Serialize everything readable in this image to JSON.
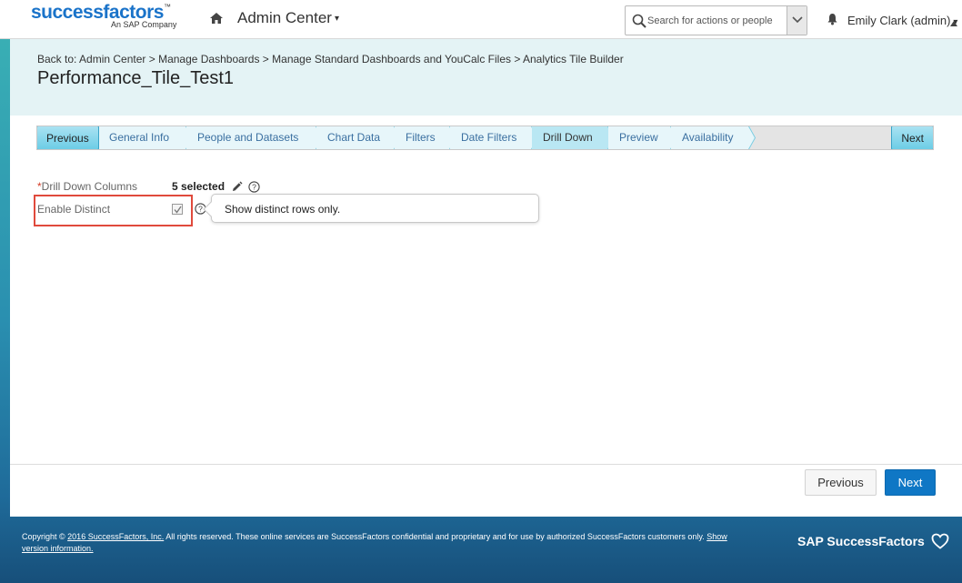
{
  "header": {
    "logo_text": "successfactors",
    "logo_tm": "™",
    "logo_sub": "An SAP Company",
    "nav_title": "Admin Center",
    "search_placeholder": "Search for actions or people",
    "user_name": "Emily Clark (admin)",
    "caret": "▾"
  },
  "title_area": {
    "breadcrumb": "Back to: Admin Center > Manage Dashboards > Manage Standard Dashboards and YouCalc Files > Analytics Tile Builder",
    "page_title": "Performance_Tile_Test1"
  },
  "wizard": {
    "previous_label": "Previous",
    "next_label": "Next",
    "steps": [
      {
        "label": "General Info",
        "active": false
      },
      {
        "label": "People and Datasets",
        "active": false
      },
      {
        "label": "Chart Data",
        "active": false
      },
      {
        "label": "Filters",
        "active": false
      },
      {
        "label": "Date Filters",
        "active": false
      },
      {
        "label": "Drill Down",
        "active": true
      },
      {
        "label": "Preview",
        "active": false
      },
      {
        "label": "Availability",
        "active": false
      }
    ]
  },
  "form": {
    "drill_down_required_mark": "*",
    "drill_down_label": "Drill Down Columns",
    "drill_down_value": "5 selected",
    "enable_distinct_label": "Enable Distinct",
    "enable_distinct_checked": true,
    "tooltip_text": "Show distinct rows only."
  },
  "actions": {
    "previous_label": "Previous",
    "next_label": "Next"
  },
  "footer": {
    "copyright_prefix": "Copyright ©",
    "copyright_link": "2016 SuccessFactors, Inc.",
    "copyright_body": "All rights reserved. These online services are SuccessFactors confidential and proprietary and for use by authorized SuccessFactors customers only.",
    "version_link": "Show version information.",
    "brand": "SAP SuccessFactors"
  },
  "colors": {
    "accent": "#0f77c5",
    "wizard_active": "#b9e7f3",
    "highlight": "#e04a3c",
    "logo_blue": "#1a73c9",
    "logo_heart": "#e4266f"
  },
  "icons": {
    "home": "home-icon",
    "search": "search-icon",
    "bell": "bell-icon",
    "edit": "pencil-icon",
    "help": "question-circle-icon",
    "heart": "heart-icon"
  }
}
